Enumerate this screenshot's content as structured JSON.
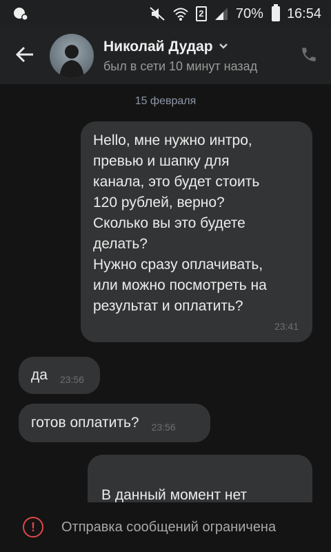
{
  "status_bar": {
    "battery_percent": "70%",
    "sim_label": "2",
    "time": "16:54",
    "icons": [
      "app-notification-icon",
      "mute-icon",
      "wifi-icon",
      "sim-icon",
      "signal-icon",
      "battery-icon"
    ]
  },
  "header": {
    "name": "Николай Дудар",
    "subtitle": "был в сети 10 минут назад",
    "icons": [
      "back-arrow-icon",
      "chevron-down-icon",
      "phone-icon"
    ]
  },
  "chat": {
    "date_separator": "15 февраля",
    "messages": [
      {
        "direction": "outgoing",
        "text": "Hello, мне нужно интро,\nпревью и шапку для\nканала, это будет стоить\n120 рублей, верно?\nСколько вы это будете\nделать?\nНужно сразу оплачивать,\nили можно посмотреть на\nрезультат и оплатить?",
        "time": "23:41"
      },
      {
        "direction": "incoming",
        "text": "да",
        "time": "23:56"
      },
      {
        "direction": "incoming",
        "text": "готов оплатить?",
        "time": "23:56"
      },
      {
        "direction": "outgoing",
        "text": "В данный момент нет\nденег, но примерно через"
      }
    ]
  },
  "bottom_bar": {
    "icon": "warning-icon",
    "text": "Отправка сообщений ограничена"
  },
  "colors": {
    "background": "#141414",
    "header": "#212223",
    "bubble": "#333435",
    "warning": "#e0464b",
    "date_text": "#8e98a8"
  }
}
